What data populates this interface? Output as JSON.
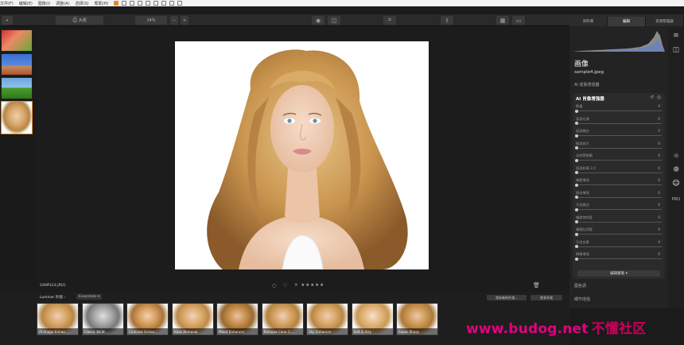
{
  "menubar": {
    "items": [
      "文件(F)",
      "编辑(E)",
      "图像(I)",
      "调整(A)",
      "选择(S)",
      "帮助(H)"
    ]
  },
  "toolbar": {
    "add_label": "+",
    "view_label": "大视",
    "zoom_value": "14%",
    "zoom_minus": "−",
    "zoom_plus": "+"
  },
  "panel": {
    "tabs": [
      "资料库",
      "编辑",
      "资源管理器"
    ],
    "title": "画像",
    "filename": "sample4.jpeg",
    "section_collapsed": "AI 皮肤增强器",
    "enhancer_title": "AI 肖像增强器",
    "sliders": [
      {
        "label": "数量",
        "value": "0"
      },
      {
        "label": "面部光源",
        "value": "0"
      },
      {
        "label": "面部美白",
        "value": "0"
      },
      {
        "label": "眼部放大",
        "value": "0"
      },
      {
        "label": "去除黑眼圈",
        "value": "0"
      },
      {
        "label": "面部轮廓 2.0",
        "value": "0"
      },
      {
        "label": "嘴唇增强",
        "value": "0"
      },
      {
        "label": "眉毛增强",
        "value": "0"
      },
      {
        "label": "牙齿美白",
        "value": "0"
      },
      {
        "label": "嘴唇饱和度",
        "value": "0"
      },
      {
        "label": "嘴唇红润度",
        "value": "0"
      },
      {
        "label": "牙齿去黄",
        "value": "0"
      },
      {
        "label": "眼睛增强",
        "value": "0"
      }
    ],
    "edit_mask": "编辑蒙版 ▾",
    "bottom_items": [
      "图色调",
      "细节增强"
    ]
  },
  "bottombar": {
    "filename": "SAMPLE4.JPEG",
    "rating": "✕ ★★★★★"
  },
  "presets": {
    "collection_label": "Luminar 外观 ›",
    "essentials_label": "Essentials ▾",
    "save_button": "保存新的外观...",
    "more_button": "更多外观",
    "items": [
      "AI Image Enhan...",
      "Classic B&W...",
      "Contrast Enhan...",
      "Haze Removal",
      "Mood Enhancer",
      "Remove Color C...",
      "Sky Enhancer",
      "Soft & Airy",
      "Super Sharp"
    ]
  },
  "watermark": {
    "url": "www.budog.net",
    "cn": "不懂社区"
  },
  "colors": {
    "accent": "#e08a2c",
    "watermark": "#e4007f"
  }
}
